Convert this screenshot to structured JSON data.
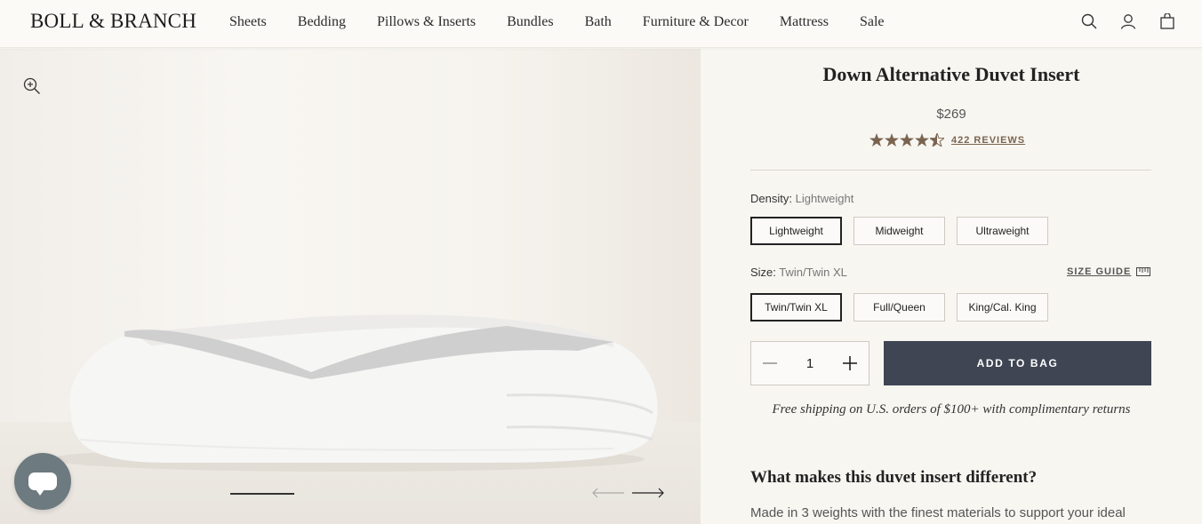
{
  "header": {
    "logo": "BOLL & BRANCH",
    "nav": [
      "Sheets",
      "Bedding",
      "Pillows & Inserts",
      "Bundles",
      "Bath",
      "Furniture & Decor",
      "Mattress",
      "Sale"
    ],
    "icons": [
      "search-icon",
      "account-icon",
      "bag-icon"
    ]
  },
  "product": {
    "title": "Down Alternative Duvet Insert",
    "price": "$269",
    "rating": 4.5,
    "reviews_label": "422 REVIEWS",
    "density": {
      "label": "Density:",
      "selected": "Lightweight",
      "options": [
        "Lightweight",
        "Midweight",
        "Ultraweight"
      ]
    },
    "size": {
      "label": "Size:",
      "selected": "Twin/Twin XL",
      "options": [
        "Twin/Twin XL",
        "Full/Queen",
        "King/Cal. King"
      ],
      "guide_label": "SIZE GUIDE"
    },
    "quantity": "1",
    "add_to_bag": "ADD TO BAG",
    "shipping_note": "Free shipping on U.S. orders of $100+ with complimentary returns",
    "section_heading": "What makes this duvet insert different?",
    "section_text": "Made in 3 weights with the finest materials to support your ideal"
  },
  "colors": {
    "accent": "#3f4553",
    "star": "#7a6450",
    "chat": "#6d7a80"
  }
}
